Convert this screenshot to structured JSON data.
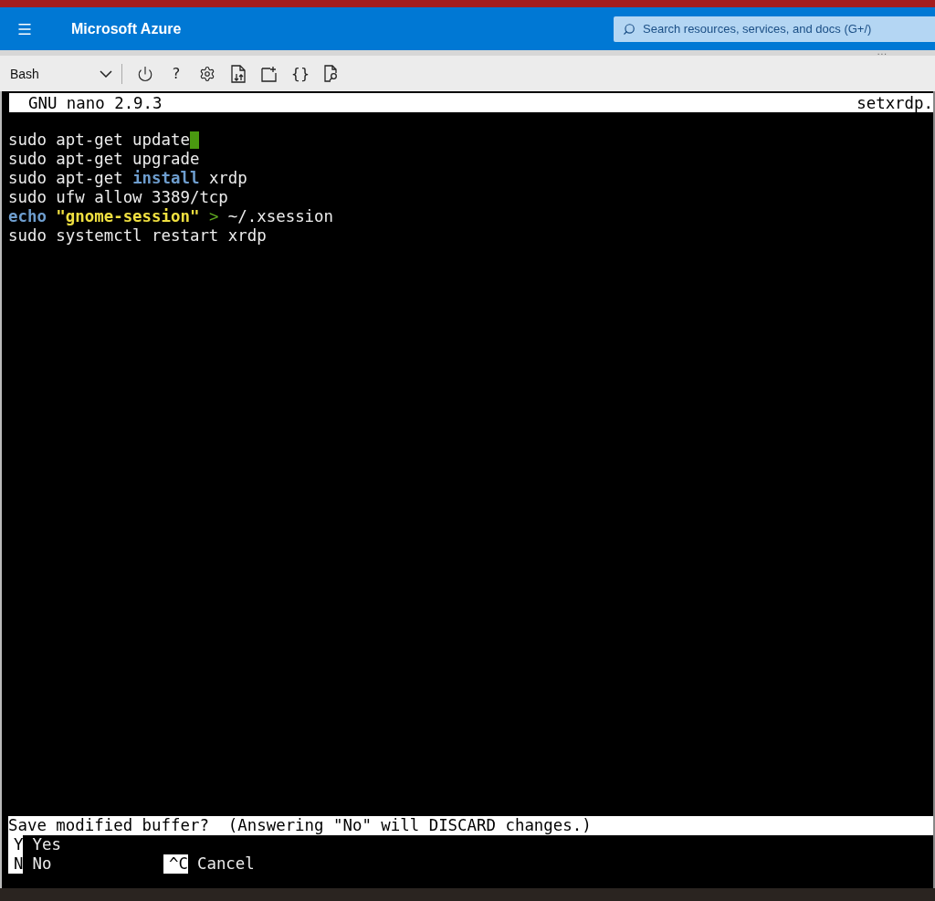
{
  "header": {
    "title": "Microsoft Azure",
    "search": {
      "placeholder": "Search resources, services, and docs (G+/)"
    },
    "more": "..."
  },
  "toolbar": {
    "shell": "Bash",
    "items": [
      {
        "kind": "power"
      },
      {
        "kind": "text",
        "label": "?"
      },
      {
        "kind": "gear"
      },
      {
        "kind": "transfer"
      },
      {
        "kind": "newfile"
      },
      {
        "kind": "text",
        "label": "{}"
      },
      {
        "kind": "preview"
      }
    ]
  },
  "editor": {
    "title": "GNU nano 2.9.3",
    "filename": "setxrdp.",
    "lines": [
      {
        "cursor": true,
        "segments": [
          {
            "kind": "plain",
            "text": "sudo apt-get update"
          }
        ]
      },
      {
        "cursor": false,
        "segments": [
          {
            "kind": "plain",
            "text": "sudo apt-get upgrade"
          }
        ]
      },
      {
        "cursor": false,
        "segments": [
          {
            "kind": "plain",
            "text": "sudo apt-get "
          },
          {
            "kind": "keyword",
            "text": "install"
          },
          {
            "kind": "plain",
            "text": " xrdp"
          }
        ]
      },
      {
        "cursor": false,
        "segments": [
          {
            "kind": "plain",
            "text": "sudo ufw allow 3389/tcp"
          }
        ]
      },
      {
        "cursor": false,
        "segments": [
          {
            "kind": "keyword",
            "text": "echo"
          },
          {
            "kind": "string",
            "text": " \"gnome-session\""
          },
          {
            "kind": "operator",
            "text": " >"
          },
          {
            "kind": "plain",
            "text": " ~/.xsession"
          }
        ]
      },
      {
        "cursor": false,
        "segments": [
          {
            "kind": "plain",
            "text": "sudo systemctl restart xrdp"
          }
        ]
      }
    ],
    "prompt": "Save modified buffer?  (Answering \"No\" will DISCARD changes.)",
    "options": [
      [
        {
          "key": "Y",
          "label": "Yes"
        }
      ],
      [
        {
          "key": "N",
          "label": "No"
        },
        {
          "key": "^C",
          "label": "Cancel"
        }
      ]
    ]
  }
}
